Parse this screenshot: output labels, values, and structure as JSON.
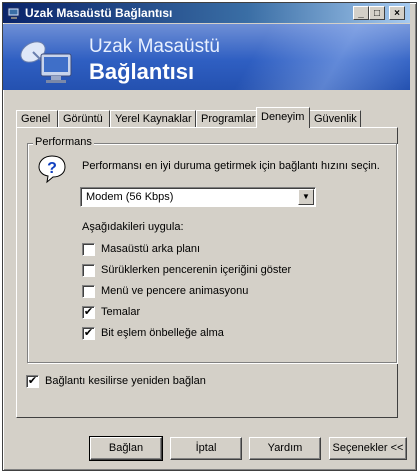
{
  "window": {
    "title": "Uzak Masaüstü Bağlantısı",
    "controls": {
      "minimize": "_",
      "maximize": "□",
      "close": "×"
    }
  },
  "banner": {
    "line1": "Uzak Masaüstü",
    "line2": "Bağlantısı",
    "logo": "monitor-satellite-icon"
  },
  "tabs": [
    {
      "label": "Genel"
    },
    {
      "label": "Görüntü"
    },
    {
      "label": "Yerel Kaynaklar"
    },
    {
      "label": "Programlar"
    },
    {
      "label": "Deneyim",
      "active": true
    },
    {
      "label": "Güvenlik"
    }
  ],
  "performance": {
    "group_label": "Performans",
    "help_icon": "question-icon",
    "description": "Performansı en iyi duruma getirmek için bağlantı hızını seçin.",
    "speed_select": {
      "value": "Modem (56 Kbps)",
      "arrow": "▼"
    },
    "apply_label": "Aşağıdakileri uygula:",
    "options": [
      {
        "label": "Masaüstü arka planı",
        "checked": false
      },
      {
        "label": "Sürüklerken pencerenin içeriğini göster",
        "checked": false
      },
      {
        "label": "Menü ve pencere animasyonu",
        "checked": false
      },
      {
        "label": "Temalar",
        "checked": true
      },
      {
        "label": "Bit eşlem önbelleğe alma",
        "checked": true
      }
    ]
  },
  "reconnect": {
    "label": "Bağlantı kesilirse yeniden bağlan",
    "checked": true
  },
  "check_mark": "✔",
  "buttons": {
    "connect": "Bağlan",
    "cancel": "İptal",
    "help": "Yardım",
    "options": "Seçenekler <<"
  }
}
